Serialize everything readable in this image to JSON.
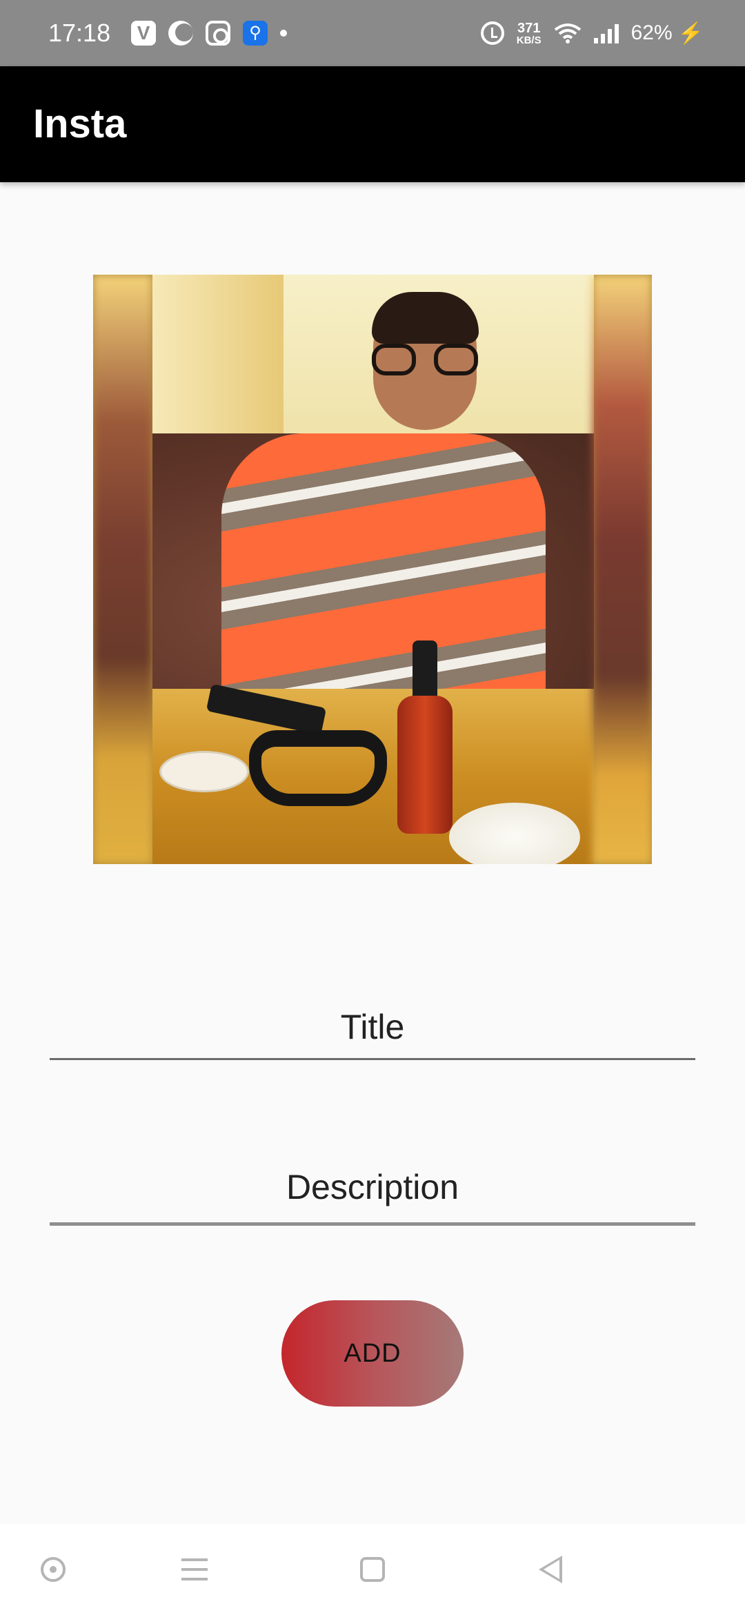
{
  "status_bar": {
    "time": "17:18",
    "icons": [
      "vpn-icon",
      "do-not-disturb-icon",
      "instagram-icon",
      "usb-icon",
      "notification-dot-icon"
    ],
    "alarm_icon": "alarm-icon",
    "net_speed_value": "371",
    "net_speed_unit": "KB/S",
    "wifi_icon": "wifi-icon",
    "signal_icon": "cell-signal-icon",
    "battery_percent": "62%",
    "charging_icon": "charging-bolt-icon",
    "background_color": "#8a8a8a"
  },
  "app_bar": {
    "title": "Insta",
    "background_color": "#000000",
    "title_color": "#ffffff"
  },
  "post_image": {
    "kind": "photo"
  },
  "form": {
    "title_field": {
      "placeholder": "Title",
      "value": ""
    },
    "description_field": {
      "placeholder": "Description",
      "value": ""
    },
    "add_button_label": "ADD",
    "add_button_colors": [
      "#c4262c",
      "#a57a78"
    ]
  },
  "nav_bar": {
    "items": [
      "assistant-icon",
      "recent-apps-icon",
      "home-icon",
      "back-icon"
    ]
  }
}
